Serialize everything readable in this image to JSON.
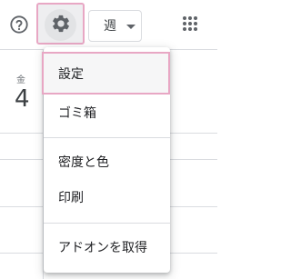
{
  "toolbar": {
    "help_icon": "help-circle-icon",
    "settings_icon": "gear-icon",
    "view_select": {
      "selected": "週"
    },
    "apps_icon": "apps-grid-icon"
  },
  "calendar": {
    "day_name": "金",
    "day_number": "4"
  },
  "settings_menu": {
    "items": [
      {
        "label": "設定"
      },
      {
        "label": "ゴミ箱"
      },
      {
        "label": "密度と色"
      },
      {
        "label": "印刷"
      },
      {
        "label": "アドオンを取得"
      }
    ]
  },
  "colors": {
    "highlight_border": "#e8a7c4",
    "divider": "#dadce0",
    "icon": "#5f6368"
  }
}
